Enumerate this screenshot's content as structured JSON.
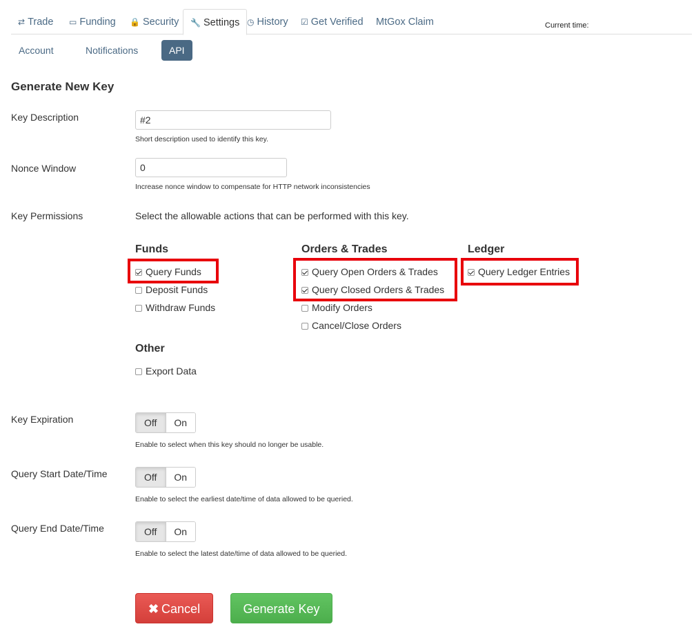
{
  "tabs": [
    {
      "label": "Trade",
      "icon": "retweet-icon",
      "glyph": "⇄"
    },
    {
      "label": "Funding",
      "icon": "money-icon",
      "glyph": "▭"
    },
    {
      "label": "Security",
      "icon": "lock-icon",
      "glyph": "🔒"
    },
    {
      "label": "Settings",
      "icon": "wrench-icon",
      "glyph": "🔧"
    },
    {
      "label": "History",
      "icon": "clock-icon",
      "glyph": "◷"
    },
    {
      "label": "Get Verified",
      "icon": "check-square-icon",
      "glyph": "☑"
    },
    {
      "label": "MtGox Claim",
      "icon": "",
      "glyph": ""
    }
  ],
  "active_tab": "Settings",
  "current_time_label": "Current time:",
  "subnav": [
    "Account",
    "Notifications",
    "API"
  ],
  "active_subnav": "API",
  "form": {
    "title": "Generate New Key",
    "key_description": {
      "label": "Key Description",
      "value": "#2",
      "help": "Short description used to identify this key."
    },
    "nonce_window": {
      "label": "Nonce Window",
      "value": "0",
      "help": "Increase nonce window to compensate for HTTP network inconsistencies"
    },
    "key_permissions": {
      "label": "Key Permissions",
      "description": "Select the allowable actions that can be performed with this key.",
      "groups": {
        "funds": {
          "title": "Funds",
          "items": [
            {
              "label": "Query Funds",
              "checked": true
            },
            {
              "label": "Deposit Funds",
              "checked": false
            },
            {
              "label": "Withdraw Funds",
              "checked": false
            }
          ]
        },
        "orders": {
          "title": "Orders & Trades",
          "items": [
            {
              "label": "Query Open Orders & Trades",
              "checked": true
            },
            {
              "label": "Query Closed Orders & Trades",
              "checked": true
            },
            {
              "label": "Modify Orders",
              "checked": false
            },
            {
              "label": "Cancel/Close Orders",
              "checked": false
            }
          ]
        },
        "ledger": {
          "title": "Ledger",
          "items": [
            {
              "label": "Query Ledger Entries",
              "checked": true
            }
          ]
        },
        "other": {
          "title": "Other",
          "items": [
            {
              "label": "Export Data",
              "checked": false
            }
          ]
        }
      }
    },
    "key_expiration": {
      "label": "Key Expiration",
      "off": "Off",
      "on": "On",
      "state": "Off",
      "help": "Enable to select when this key should no longer be usable."
    },
    "query_start": {
      "label": "Query Start Date/Time",
      "off": "Off",
      "on": "On",
      "state": "Off",
      "help": "Enable to select the earliest date/time of data allowed to be queried."
    },
    "query_end": {
      "label": "Query End Date/Time",
      "off": "Off",
      "on": "On",
      "state": "Off",
      "help": "Enable to select the latest date/time of data allowed to be queried."
    },
    "buttons": {
      "cancel": "Cancel",
      "cancel_icon": "times-icon",
      "generate": "Generate Key"
    }
  },
  "colors": {
    "link": "#4b6a85",
    "active_pill": "#4a6984",
    "highlight": "#e8000b",
    "cancel": "#d9534f",
    "generate": "#5cb85c"
  }
}
